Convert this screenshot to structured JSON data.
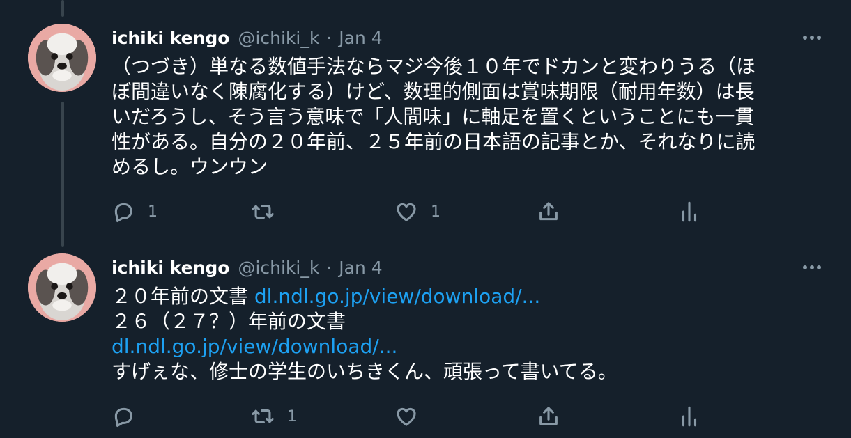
{
  "tweets": [
    {
      "author_name": "ichiki kengo",
      "handle": "@ichiki_k",
      "separator": "·",
      "date": "Jan 4",
      "lines": [
        "（つづき）単なる数値手法ならマジ今後１０年でドカンと変わりうる（ほ",
        "ぼ間違いなく陳腐化する）けど、数理的側面は賞味期限（耐用年数）は長",
        "いだろうし、そう言う意味で「人間味」に軸足を置くということにも一貫",
        "性がある。自分の２０年前、２５年前の日本語の記事とか、それなりに読",
        "めるし。ウンウン"
      ],
      "counts": {
        "reply": "1",
        "retweet": "",
        "like": "1"
      }
    },
    {
      "author_name": "ichiki kengo",
      "handle": "@ichiki_k",
      "separator": "·",
      "date": "Jan 4",
      "line1_text": "２０年前の文書 ",
      "line1_link": "dl.ndl.go.jp/view/download/...",
      "line2_text": "２６（２７？）年前の文書",
      "line3_link": "dl.ndl.go.jp/view/download/...",
      "line4_text": "すげぇな、修士の学生のいちきくん、頑張って書いてる。",
      "counts": {
        "reply": "",
        "retweet": "1",
        "like": ""
      }
    }
  ],
  "colors": {
    "background": "#15202b",
    "secondary_text": "#8899a6",
    "link": "#1da1f2",
    "thread_line": "#38444d"
  },
  "icons": [
    "more-icon",
    "reply-icon",
    "retweet-icon",
    "like-icon",
    "share-icon",
    "analytics-icon"
  ]
}
